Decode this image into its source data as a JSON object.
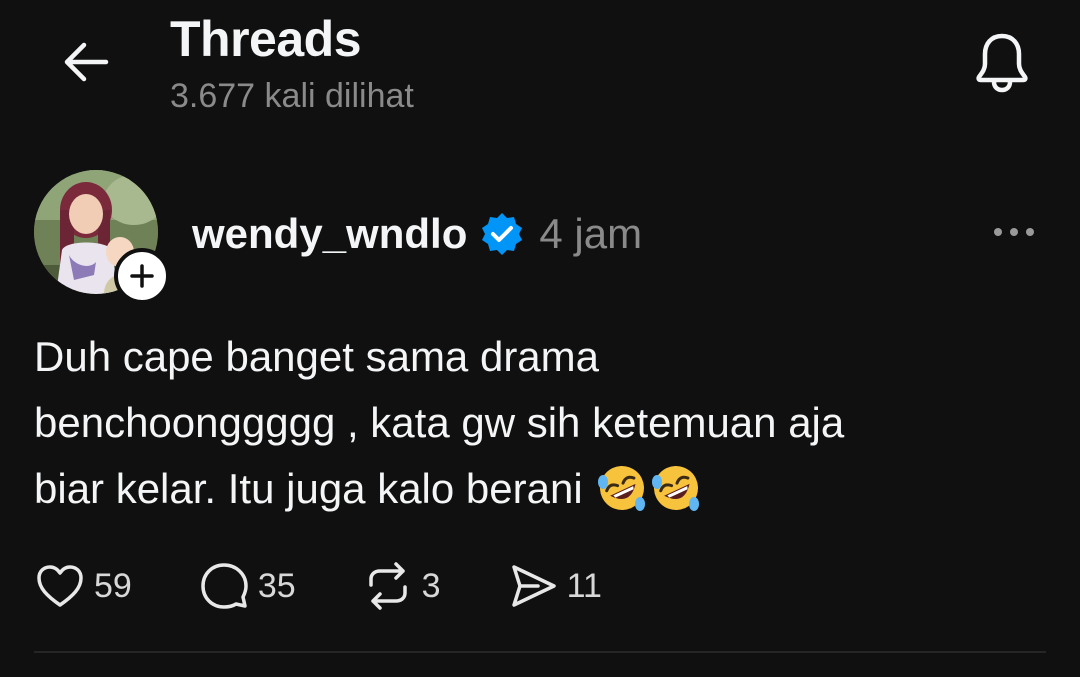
{
  "header": {
    "title": "Threads",
    "views": "3.677 kali dilihat"
  },
  "post": {
    "username": "wendy_wndlo",
    "verified": true,
    "time": "4 jam",
    "text_lines": [
      "Duh cape banget sama drama",
      "benchoonggggg , kata gw sih ketemuan aja",
      "biar kelar. Itu juga kalo berani"
    ],
    "emojis": [
      "rolling-on-floor-laughing",
      "rolling-on-floor-laughing"
    ],
    "actions": {
      "likes": "59",
      "replies": "35",
      "reposts": "3",
      "shares": "11"
    }
  },
  "colors": {
    "background": "#101010",
    "text": "#f3f5f7",
    "muted": "#8a8a8a",
    "verified_blue": "#0095f6",
    "divider": "#262626"
  },
  "icons": {
    "back": "arrow-left-icon",
    "bell": "bell-icon",
    "more": "more-dots-icon",
    "like": "heart-icon",
    "reply": "comment-icon",
    "repost": "repost-icon",
    "share": "send-icon"
  }
}
